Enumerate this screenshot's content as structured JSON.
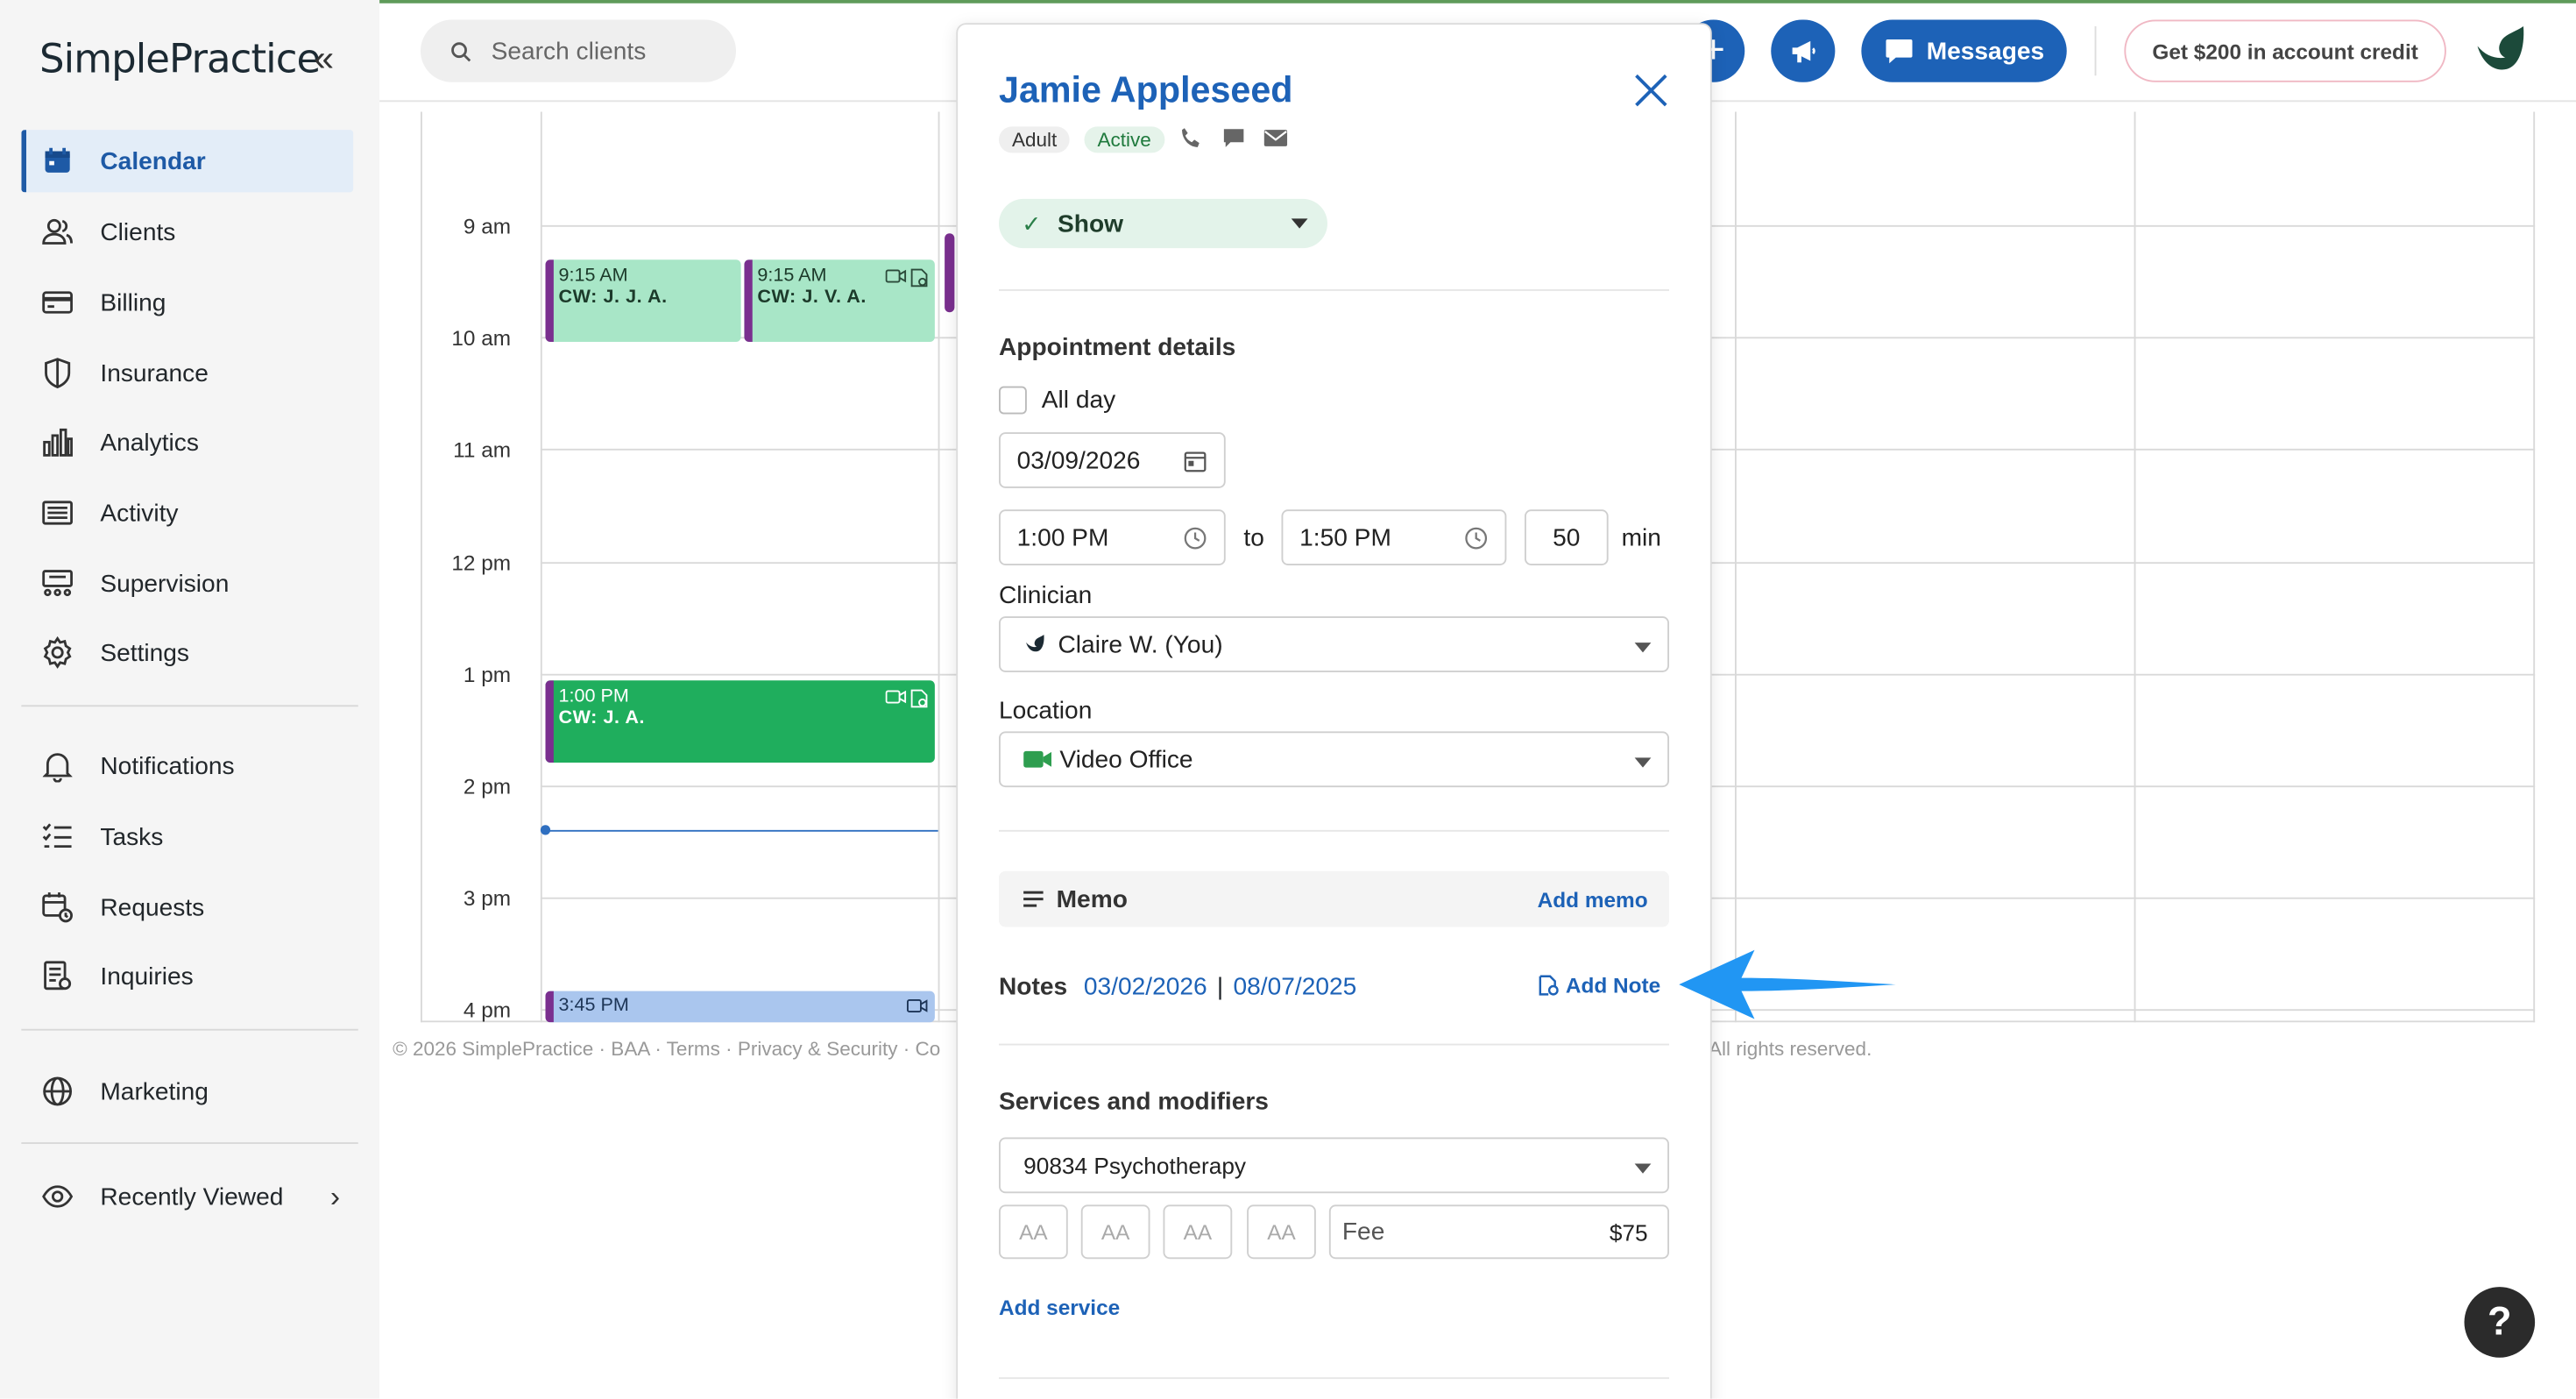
{
  "app": {
    "logo_text": "SimplePractice",
    "collapse_glyph": "«"
  },
  "sidebar": {
    "items": [
      {
        "label": "Calendar",
        "icon": "calendar-icon",
        "active": true
      },
      {
        "label": "Clients",
        "icon": "clients-icon"
      },
      {
        "label": "Billing",
        "icon": "billing-icon"
      },
      {
        "label": "Insurance",
        "icon": "insurance-icon"
      },
      {
        "label": "Analytics",
        "icon": "analytics-icon"
      },
      {
        "label": "Activity",
        "icon": "activity-icon"
      },
      {
        "label": "Supervision",
        "icon": "supervision-icon"
      },
      {
        "label": "Settings",
        "icon": "settings-icon"
      },
      {
        "label": "Notifications",
        "icon": "bell-icon"
      },
      {
        "label": "Tasks",
        "icon": "tasks-icon"
      },
      {
        "label": "Requests",
        "icon": "requests-icon"
      },
      {
        "label": "Inquiries",
        "icon": "inquiries-icon"
      },
      {
        "label": "Marketing",
        "icon": "globe-icon"
      },
      {
        "label": "Recently Viewed",
        "icon": "eye-icon"
      }
    ]
  },
  "topbar": {
    "search_placeholder": "Search clients",
    "plus_label": "+",
    "messages_label": "Messages",
    "credit_label": "Get $200 in account credit"
  },
  "calendar": {
    "time_labels": [
      "9 am",
      "10 am",
      "11 am",
      "12 pm",
      "1 pm",
      "2 pm",
      "3 pm",
      "4 pm"
    ],
    "appointments": [
      {
        "time": "9:15 AM",
        "who": "CW: J. J. A.",
        "color": "#a8e6c7"
      },
      {
        "time": "9:15 AM",
        "who": "CW: J. V. A.",
        "color": "#a8e6c7"
      },
      {
        "time": "1:00 PM",
        "who": "CW: J. A.",
        "color": "#1fae5d"
      },
      {
        "time": "3:45 PM",
        "who": "",
        "color": "#aac6ee"
      }
    ],
    "footer_left": "© 2026 SimplePractice · BAA · Terms · Privacy & Security · Co",
    "footer_right": "All rights reserved."
  },
  "panel": {
    "client_name": "Jamie Appleseed",
    "tags": {
      "adult": "Adult",
      "active": "Active"
    },
    "status": "Show",
    "appointment_details_title": "Appointment details",
    "all_day_label": "All day",
    "date": "03/09/2026",
    "start_time": "1:00 PM",
    "to_label": "to",
    "end_time": "1:50 PM",
    "duration": "50",
    "duration_unit": "min",
    "clinician_label": "Clinician",
    "clinician": "Claire W. (You)",
    "location_label": "Location",
    "location": "Video Office",
    "memo_label": "Memo",
    "add_memo": "Add memo",
    "notes_label": "Notes",
    "note_date_1": "03/02/2026",
    "notes_separator": "|",
    "note_date_2": "08/07/2025",
    "add_note": "Add Note",
    "services_title": "Services and modifiers",
    "service": "90834 Psychotherapy",
    "modifier_placeholder": "AA",
    "fee_label": "Fee",
    "fee_value": "$75",
    "add_service": "Add service"
  },
  "help_label": "?",
  "colors": {
    "brand_blue": "#1d62b7",
    "active_nav_bg": "#e3edf8",
    "show_bg": "#e3f3ea",
    "annotation_arrow": "#2196f3"
  }
}
